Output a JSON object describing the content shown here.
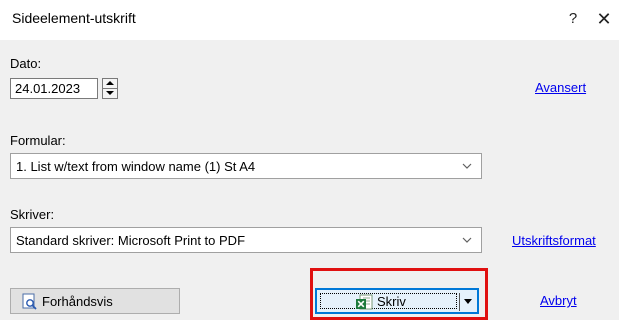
{
  "window": {
    "title": "Sideelement-utskrift",
    "help_label": "?",
    "close_label": "✕"
  },
  "date": {
    "label": "Dato:",
    "value": "24.01.2023"
  },
  "advanced_link": "Avansert",
  "form": {
    "label": "Formular:",
    "selected": "1. List w/text from window name (1) St A4"
  },
  "printer": {
    "label": "Skriver:",
    "selected": "Standard skriver: Microsoft Print to PDF"
  },
  "print_format_link": "Utskriftsformat",
  "buttons": {
    "preview": "Forhåndsvis",
    "print": "Skriv",
    "cancel": "Avbryt"
  },
  "colors": {
    "accent": "#0078d7",
    "highlight_border": "#e01010",
    "link": "#0000ee"
  },
  "icons": {
    "preview": "magnifier-page-icon",
    "print": "excel-icon"
  }
}
